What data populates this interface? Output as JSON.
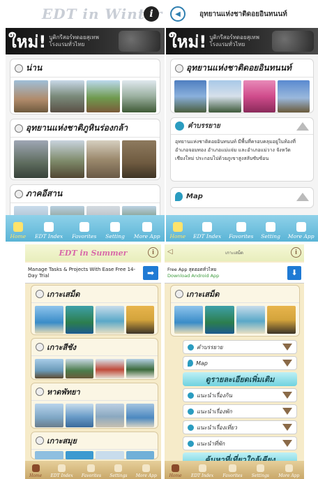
{
  "winter": {
    "logo": "EDT in Winter",
    "banner_big": "ใหม่!",
    "banner_small1": "บูติกรีสอร์ทดอยสุเทพ",
    "banner_small2": "โรงแรมทั่วไทย",
    "sections": [
      {
        "title": "น่าน"
      },
      {
        "title": "อุทยานแห่งชาติภูหินร่องกล้า"
      },
      {
        "title": "ภาคอีสาน"
      }
    ]
  },
  "detail_winter": {
    "header_title": "อุทยานแห่งชาติดอยอินทนนท์",
    "banner_big": "ใหม่!",
    "banner_small1": "บูติกรีสอร์ทดอยสุเทพ",
    "banner_small2": "โรงแรมทั่วไทย",
    "section_title": "อุทยานแห่งชาติดอยอินทนนท์",
    "desc_label": "คำบรรยาย",
    "desc_text": "อุทยานแห่งชาติดอยอินทนนท์ มีพื้นที่ครอบคลุมอยู่ในท้องที่ อำเภอจอมทอง อำเภอแม่แจ่ม และอำเภอแม่วาง จังหวัดเชียงใหม่ ประกอบไปด้วยภูเขาสูงสลับซับซ้อน",
    "map_label": "Map"
  },
  "tabbar": [
    "Home",
    "EDT Index",
    "Favorites",
    "Setting",
    "More App"
  ],
  "summer": {
    "logo": "EDT in Summer",
    "ad_text": "Manage Tasks & Projects With Ease Free 14-Day Trial",
    "sections": [
      {
        "title": "เกาะเสม็ด"
      },
      {
        "title": "เกาะสีชัง"
      },
      {
        "title": "หาดพัทยา"
      },
      {
        "title": "เกาะสมุย"
      }
    ]
  },
  "detail_summer": {
    "header_title": "เกาะเสม็ด",
    "ad_line1": "Free App สุดฮอตทั่วไทย",
    "ad_line2": "Download Android App",
    "section_title": "เกาะเสม็ด",
    "rows": [
      "คำบรรยาย",
      "Map"
    ],
    "more_info": "ดูรายละเอียดเพิ่มเติม",
    "rows2": [
      "แนะนำเรื่องกิน",
      "แนะนำเรื่องพัก",
      "แนะนำเรื่องเที่ยว",
      "แนะนำที่พัก"
    ],
    "nearby": "ค้นหาที่เที่ยวใกล้เคียง"
  },
  "tabbar_summer": [
    "Home",
    "EDT Index",
    "Favorites",
    "Settings",
    "More App"
  ]
}
